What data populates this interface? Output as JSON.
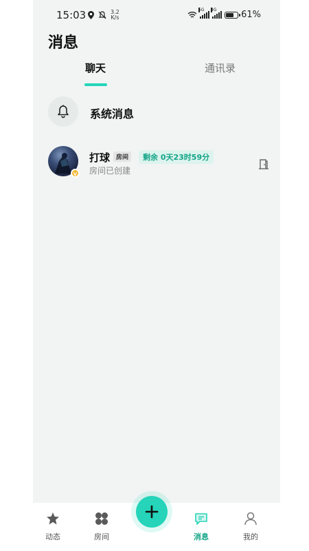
{
  "status_bar": {
    "time": "15:03",
    "net_speed_value": "3.2",
    "net_speed_unit": "K/s",
    "sim1_label": "5G",
    "sim2_label": "4G",
    "battery": "61%"
  },
  "header": {
    "title": "消息"
  },
  "tabs": [
    {
      "label": "聊天",
      "active": true
    },
    {
      "label": "通讯录",
      "active": false
    }
  ],
  "system_message": {
    "label": "系统消息",
    "icon": "bell-icon"
  },
  "chats": [
    {
      "name": "打球",
      "badge": "房间",
      "remaining": "剩余 0天23时59分",
      "subtitle": "房间已创建",
      "avatar_badge": "V",
      "action_icon": "door-icon"
    }
  ],
  "bottom_nav": {
    "items": [
      {
        "label": "动态",
        "icon": "star-icon",
        "active": false
      },
      {
        "label": "房间",
        "icon": "clover-icon",
        "active": false
      },
      {
        "label": "消息",
        "icon": "chat-bubble-icon",
        "active": true
      },
      {
        "label": "我的",
        "icon": "person-icon",
        "active": false
      }
    ],
    "fab_icon": "plus-icon"
  },
  "colors": {
    "accent": "#25d4b9",
    "accent_text": "#14a587",
    "background": "#f1f4f3"
  }
}
